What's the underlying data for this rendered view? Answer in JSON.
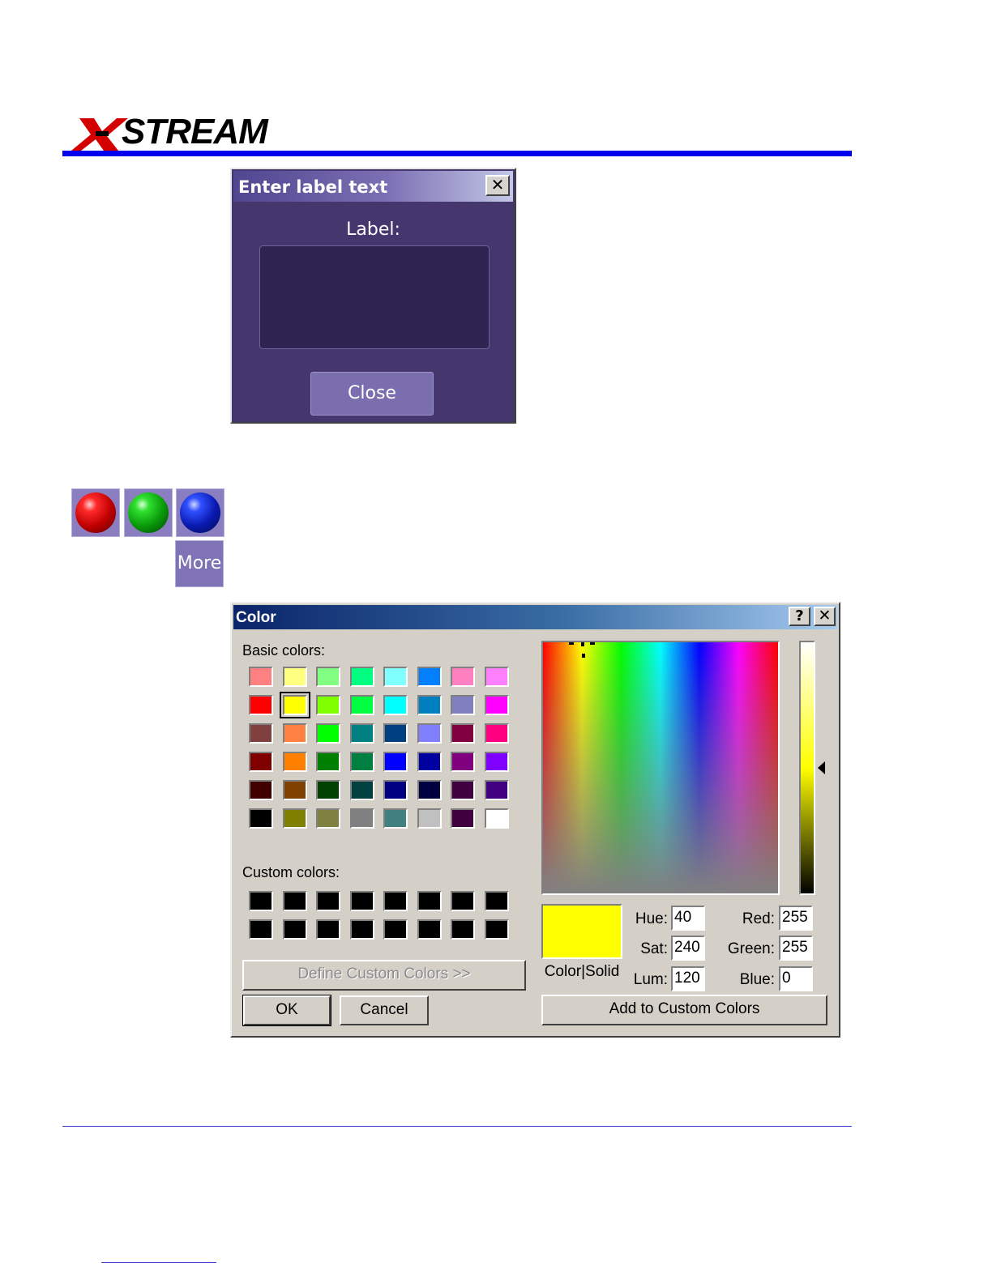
{
  "header": {
    "logo_text": "X-STREAM"
  },
  "label_dialog": {
    "title": "Enter label text",
    "close_x": "✕",
    "field_label": "Label:",
    "text_value": "",
    "close_button": "Close"
  },
  "color_buttons": {
    "red": "red",
    "green": "green",
    "blue": "blue",
    "more": "More"
  },
  "color_dialog": {
    "title": "Color",
    "help_button": "?",
    "close_button": "✕",
    "basic_colors_label": "Basic colors:",
    "custom_colors_label": "Custom colors:",
    "basic_colors": [
      "#ff8080",
      "#ffff80",
      "#80ff80",
      "#00ff80",
      "#80ffff",
      "#0080ff",
      "#ff80c0",
      "#ff80ff",
      "#ff0000",
      "#ffff00",
      "#80ff00",
      "#00ff40",
      "#00ffff",
      "#0080c0",
      "#8080c0",
      "#ff00ff",
      "#804040",
      "#ff8040",
      "#00ff00",
      "#008080",
      "#004080",
      "#8080ff",
      "#800040",
      "#ff0080",
      "#800000",
      "#ff8000",
      "#008000",
      "#008040",
      "#0000ff",
      "#0000a0",
      "#800080",
      "#8000ff",
      "#400000",
      "#804000",
      "#004000",
      "#004040",
      "#000080",
      "#000040",
      "#400040",
      "#400080",
      "#000000",
      "#808000",
      "#808040",
      "#808080",
      "#408080",
      "#c0c0c0",
      "#400040",
      "#ffffff"
    ],
    "selected_basic_index": 9,
    "custom_colors": [
      "#000000",
      "#000000",
      "#000000",
      "#000000",
      "#000000",
      "#000000",
      "#000000",
      "#000000",
      "#000000",
      "#000000",
      "#000000",
      "#000000",
      "#000000",
      "#000000",
      "#000000",
      "#000000"
    ],
    "define_custom_button": "Define Custom Colors >>",
    "ok_button": "OK",
    "cancel_button": "Cancel",
    "preview_color": "#ffff00",
    "preview_label": "Color|Solid",
    "hue_label": "Hue:",
    "hue_value": "40",
    "sat_label": "Sat:",
    "sat_value": "240",
    "lum_label": "Lum:",
    "lum_value": "120",
    "red_label": "Red:",
    "red_value": "255",
    "green_label": "Green:",
    "green_value": "255",
    "blue_label": "Blue:",
    "blue_value": "0",
    "add_custom_button": "Add to Custom Colors"
  }
}
